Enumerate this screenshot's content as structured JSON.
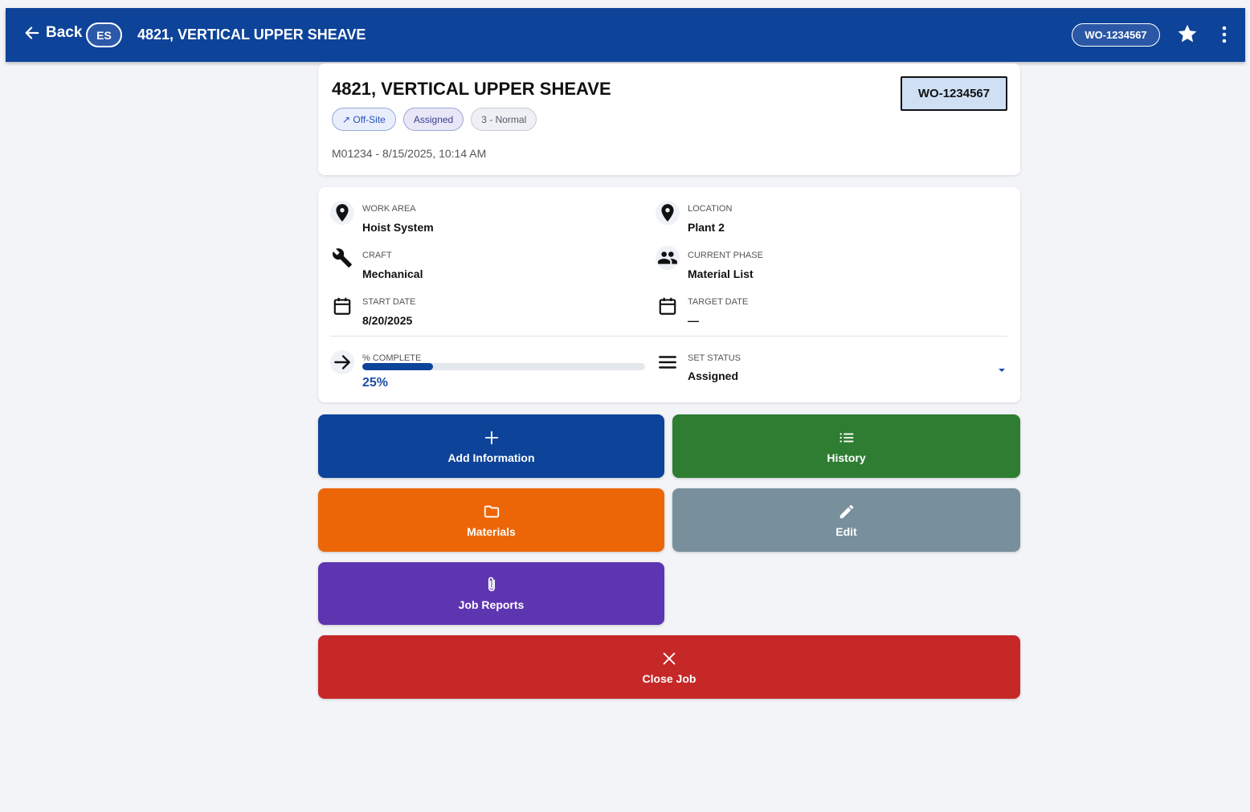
{
  "appbar": {
    "back_label": "Back",
    "lang_badge": "ES",
    "title": "4821, VERTICAL UPPER SHEAVE",
    "wo_chip": "WO-1234567"
  },
  "header": {
    "title": "4821, VERTICAL UPPER SHEAVE",
    "wo_number": "WO-1234567",
    "chips": {
      "offsite": "↗ Off-Site",
      "status": "Assigned",
      "priority": "3 - Normal"
    },
    "meta": "M01234 - 8/15/2025, 10:14 AM"
  },
  "details": {
    "work_area": {
      "label": "WORK AREA",
      "value": "Hoist System"
    },
    "location": {
      "label": "LOCATION",
      "value": "Plant 2"
    },
    "craft": {
      "label": "CRAFT",
      "value": "Mechanical"
    },
    "current_phase": {
      "label": "CURRENT PHASE",
      "value": "Material List"
    },
    "start_date": {
      "label": "START DATE",
      "value": "8/20/2025"
    },
    "target_date": {
      "label": "TARGET DATE",
      "value": "—"
    },
    "percent_complete": {
      "label": "% COMPLETE",
      "value_text": "25%",
      "fraction": 0.25
    },
    "set_status": {
      "label": "SET STATUS",
      "value": "Assigned"
    }
  },
  "actions": {
    "add_information": "Add Information",
    "history": "History",
    "materials": "Materials",
    "edit": "Edit",
    "job_reports": "Job Reports",
    "close_job": "Close Job"
  },
  "colors": {
    "appbar": "#0d4399",
    "add_information": "#0d4399",
    "history": "#2e7d32",
    "materials": "#ec6608",
    "edit": "#78909c",
    "job_reports": "#5e35b1",
    "close_job": "#c62828"
  },
  "icons": {
    "back": "arrow-left-icon",
    "favorite": "star-icon",
    "more": "more-vertical-icon",
    "work_area": "map-pin-icon",
    "location": "map-pin-icon",
    "craft": "wrench-icon",
    "current_phase": "people-icon",
    "start_date": "calendar-icon",
    "target_date": "calendar-icon",
    "percent_complete": "arrow-right-icon",
    "set_status": "menu-lines-icon",
    "add_information": "plus-icon",
    "history": "list-icon",
    "materials": "folder-icon",
    "edit": "pencil-icon",
    "job_reports": "paperclip-icon",
    "close_job": "close-icon"
  }
}
